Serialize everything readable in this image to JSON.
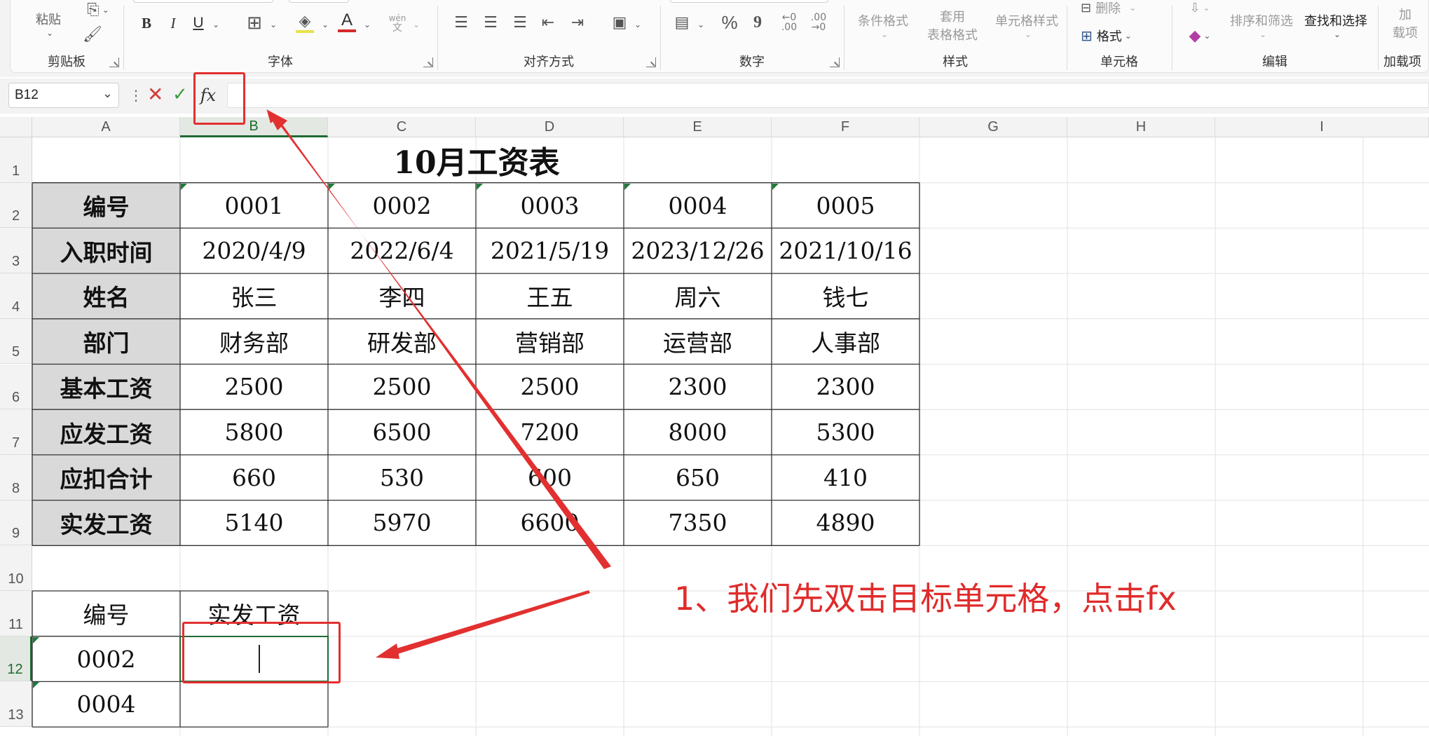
{
  "ribbon": {
    "clipboard": {
      "paste_label": "粘贴",
      "group_label": "剪贴板"
    },
    "font": {
      "group_label": "字体",
      "bold": "B",
      "italic": "I",
      "underline": "U",
      "font_color_glyph": "A",
      "phonetic_top": "wén",
      "phonetic_bottom": "文",
      "underline_color": "#d62a2a"
    },
    "alignment": {
      "group_label": "对齐方式"
    },
    "number": {
      "group_label": "数字",
      "percent": "%",
      "comma": "9",
      "inc_decimal": "←0 .00",
      "dec_decimal": ".00 →0"
    },
    "styles": {
      "group_label": "样式",
      "conditional_format": "条件格式",
      "table_format_1": "套用",
      "table_format_2": "表格格式",
      "cell_styles": "单元格样式"
    },
    "cells": {
      "group_label": "单元格",
      "delete": "删除",
      "format": "格式"
    },
    "editing": {
      "group_label": "编辑",
      "sort_filter": "排序和筛选",
      "find_select": "查找和选择"
    },
    "addins": {
      "group_label": "加载项",
      "line1": "加",
      "line2": "载项"
    }
  },
  "formula_bar": {
    "name_box": "B12",
    "cancel": "✕",
    "enter": "✓",
    "fx": "fx",
    "value": ""
  },
  "columns": [
    "A",
    "B",
    "C",
    "D",
    "E",
    "F",
    "G",
    "H",
    "I"
  ],
  "rows": [
    "1",
    "2",
    "3",
    "4",
    "5",
    "6",
    "7",
    "8",
    "9",
    "10",
    "11",
    "12",
    "13"
  ],
  "selected": {
    "col": "B",
    "row": "12"
  },
  "sheet": {
    "title": "10月工资表",
    "table": [
      [
        "编号",
        "0001",
        "0002",
        "0003",
        "0004",
        "0005"
      ],
      [
        "入职时间",
        "2020/4/9",
        "2022/6/4",
        "2021/5/19",
        "2023/12/26",
        "2021/10/16"
      ],
      [
        "姓名",
        "张三",
        "李四",
        "王五",
        "周六",
        "钱七"
      ],
      [
        "部门",
        "财务部",
        "研发部",
        "营销部",
        "运营部",
        "人事部"
      ],
      [
        "基本工资",
        "2500",
        "2500",
        "2500",
        "2300",
        "2300"
      ],
      [
        "应发工资",
        "5800",
        "6500",
        "7200",
        "8000",
        "5300"
      ],
      [
        "应扣合计",
        "660",
        "530",
        "600",
        "650",
        "410"
      ],
      [
        "实发工资",
        "5140",
        "5970",
        "6600",
        "7350",
        "4890"
      ]
    ],
    "lookup": {
      "headers": [
        "编号",
        "实发工资"
      ],
      "rows": [
        [
          "0002",
          ""
        ],
        [
          "0004",
          ""
        ]
      ]
    }
  },
  "annotation": {
    "text": "1、我们先双击目标单元格，点击fx",
    "color": "#e02b2b"
  }
}
